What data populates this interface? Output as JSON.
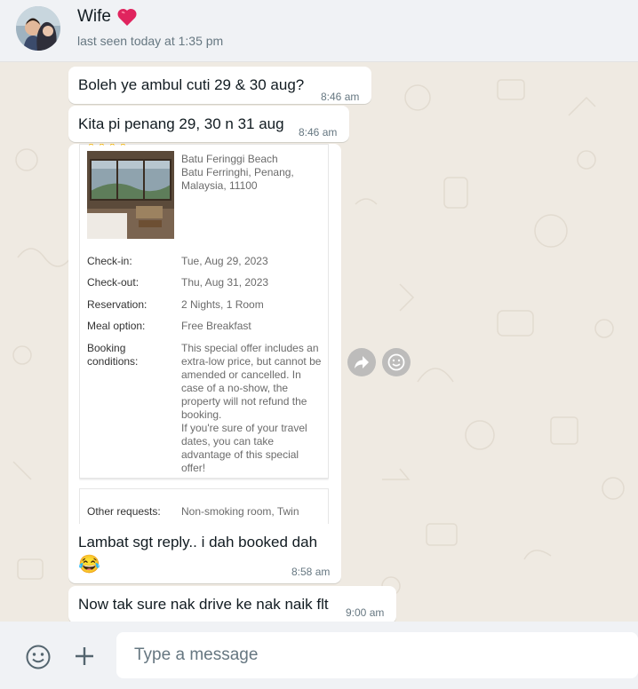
{
  "header": {
    "contact_name": "Wife",
    "last_seen": "last seen today at 1:35 pm"
  },
  "messages": [
    {
      "text": "Boleh ye ambul cuti 29 & 30 aug?",
      "time": "8:46 am"
    },
    {
      "text": "Kita pi penang 29, 30 n 31 aug",
      "time": "8:46 am"
    },
    {
      "text": "Lambat sgt reply.. i dah booked dah",
      "emoji": "😂",
      "time": "8:58 am"
    },
    {
      "text": "Now tak sure nak drive ke nak naik flt",
      "time": "9:00 am"
    }
  ],
  "booking": {
    "stars": "★★★★",
    "address": "Batu Feringgi Beach\nBatu Ferringhi, Penang,\nMalaysia, 11100",
    "checkin_label": "Check-in:",
    "checkin_value": "Tue, Aug 29, 2023",
    "checkout_label": "Check-out:",
    "checkout_value": "Thu, Aug 31, 2023",
    "reservation_label": "Reservation:",
    "reservation_value": "2 Nights, 1 Room",
    "meal_label": "Meal option:",
    "meal_value": "Free Breakfast",
    "conditions_label": "Booking\nconditions:",
    "conditions_value": "This special offer includes an extra-low price, but cannot be amended or cancelled. In case of a no-show, the property will not refund the booking.\n If you're sure of your travel dates, you can take advantage of this special offer!",
    "other_label": "Other requests:",
    "other_value": "Non-smoking room, Twin"
  },
  "composer": {
    "placeholder": "Type a message"
  },
  "icons": {
    "heart": "heart-icon",
    "forward": "forward-icon",
    "react": "smiley-icon",
    "emoji": "emoji-icon",
    "attach": "plus-icon"
  },
  "colors": {
    "chat_bg": "#efeae2",
    "bubble": "#ffffff",
    "header_bg": "#f0f2f5",
    "heart": "#e0245e"
  }
}
